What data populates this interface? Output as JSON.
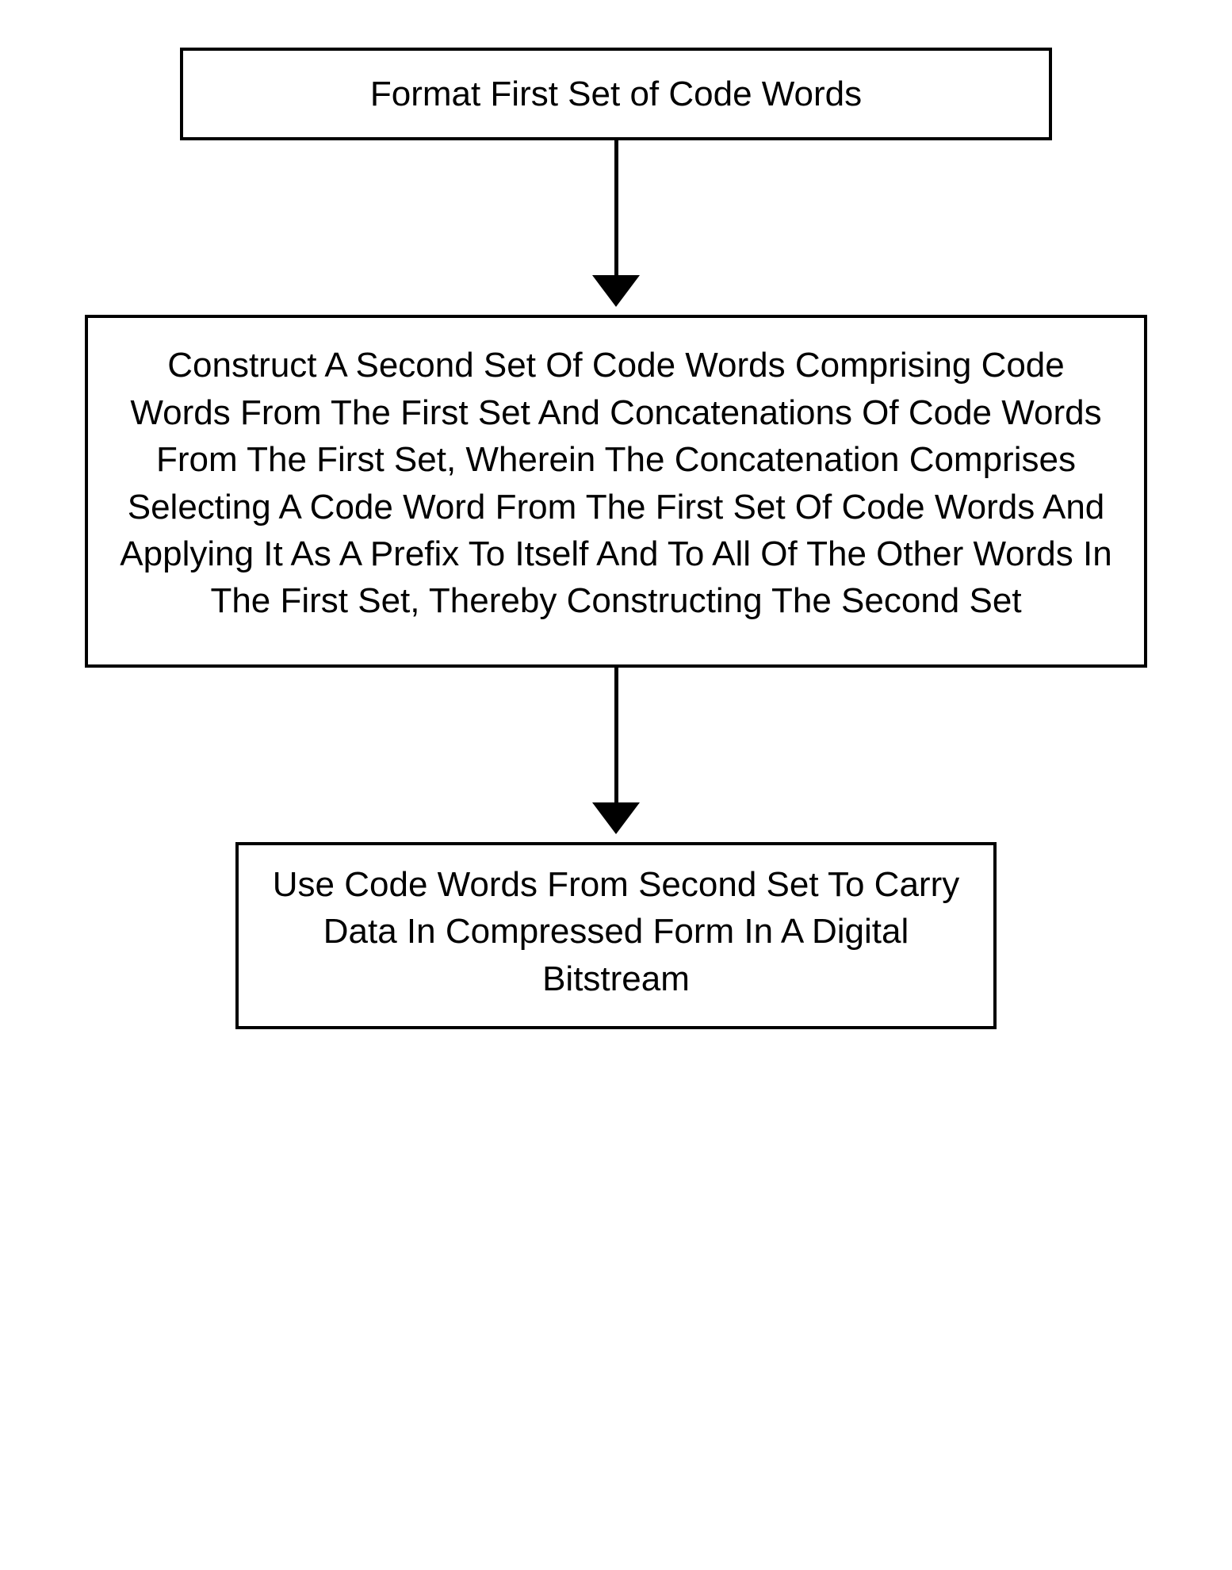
{
  "flowchart": {
    "boxes": [
      {
        "text": "Format First Set of Code Words"
      },
      {
        "text": "Construct A Second Set Of Code Words Comprising Code Words From The First Set And Concatenations Of Code Words From The First Set, Wherein The Concatenation Comprises Selecting A Code Word From The First Set Of Code Words And Applying It As A Prefix To Itself And To All Of The Other Words In The First Set, Thereby Constructing The Second Set"
      },
      {
        "text": "Use Code Words From Second Set To Carry Data In Compressed Form In A Digital Bitstream"
      }
    ]
  }
}
